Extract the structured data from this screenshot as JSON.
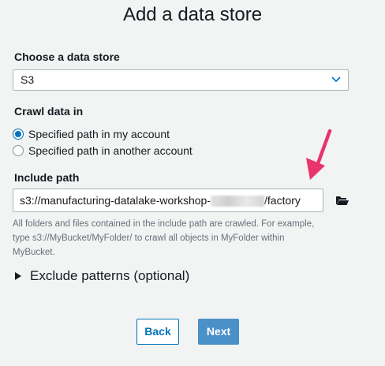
{
  "title": "Add a data store",
  "data_store": {
    "label": "Choose a data store",
    "selected": "S3"
  },
  "crawl": {
    "label": "Crawl data in",
    "options": [
      {
        "label": "Specified path in my account",
        "checked": true
      },
      {
        "label": "Specified path in another account",
        "checked": false
      }
    ]
  },
  "include_path": {
    "label": "Include path",
    "value_prefix": "s3://manufacturing-datalake-workshop-",
    "value_suffix": "/factory",
    "help_line1": "All folders and files contained in the include path are crawled. For example,",
    "help_line2": "type s3://MyBucket/MyFolder/ to crawl all objects in MyFolder within",
    "help_line3": "MyBucket."
  },
  "exclude": {
    "label": "Exclude patterns (optional)"
  },
  "buttons": {
    "back": "Back",
    "next": "Next"
  },
  "colors": {
    "accent": "#0073bb",
    "next_bg": "#4a90c9",
    "annotation_arrow": "#e8336b"
  },
  "icons": {
    "select": "chevron-down-icon",
    "browse": "folder-open-icon",
    "exclude": "caret-right-icon",
    "annotation": "red-arrow-icon"
  }
}
